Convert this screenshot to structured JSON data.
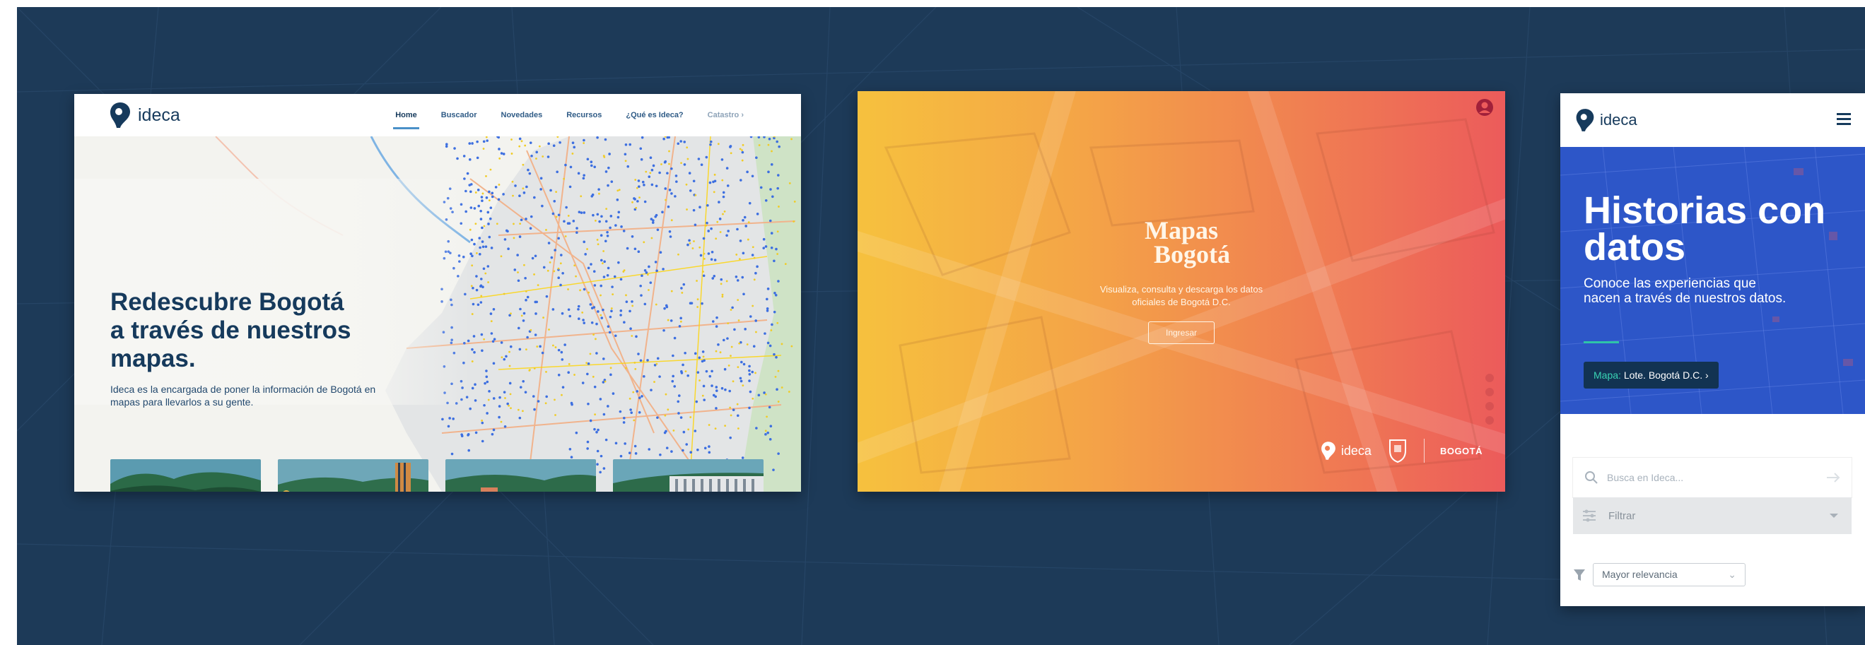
{
  "colors": {
    "page_bg": "#1d3a58",
    "ideca_navy": "#163a5c",
    "nav_blue": "#2f5b86",
    "hero_blue": "#2d56c8",
    "accent_teal": "#2ec4a8"
  },
  "card_home": {
    "logo": "ideca",
    "nav": [
      {
        "label": "Home",
        "state": "active"
      },
      {
        "label": "Buscador"
      },
      {
        "label": "Novedades"
      },
      {
        "label": "Recursos"
      },
      {
        "label": "¿Qué es Ideca?"
      },
      {
        "label": "Catastro ›",
        "state": "muted"
      }
    ],
    "hero_title": "Redescubre Bogotá\na través de nuestros\nmapas.",
    "hero_desc": "Ideca es la encargada de poner la información de Bogotá en mapas para llevarlos a su gente.",
    "thumbnails": 4
  },
  "card_mapas": {
    "title_line1": "Mapas",
    "title_line2": "Bogotá",
    "subtitle": "Visualiza, consulta y descarga los datos oficiales de Bogotá D.C.",
    "button": "Ingresar",
    "footer_ideca": "ideca",
    "footer_bogota": "BOGOTÁ"
  },
  "card_mobile": {
    "logo": "ideca",
    "hero_title": "Historias con\ndatos",
    "hero_desc": "Conoce las experiencias que nacen a través de nuestros datos.",
    "map_button_prefix": "Mapa:",
    "map_button_label": "Lote. Bogotá D.C. ›",
    "search_placeholder": "Busca en Ideca...",
    "filter_label": "Filtrar",
    "sort_selected": "Mayor relevancia"
  }
}
